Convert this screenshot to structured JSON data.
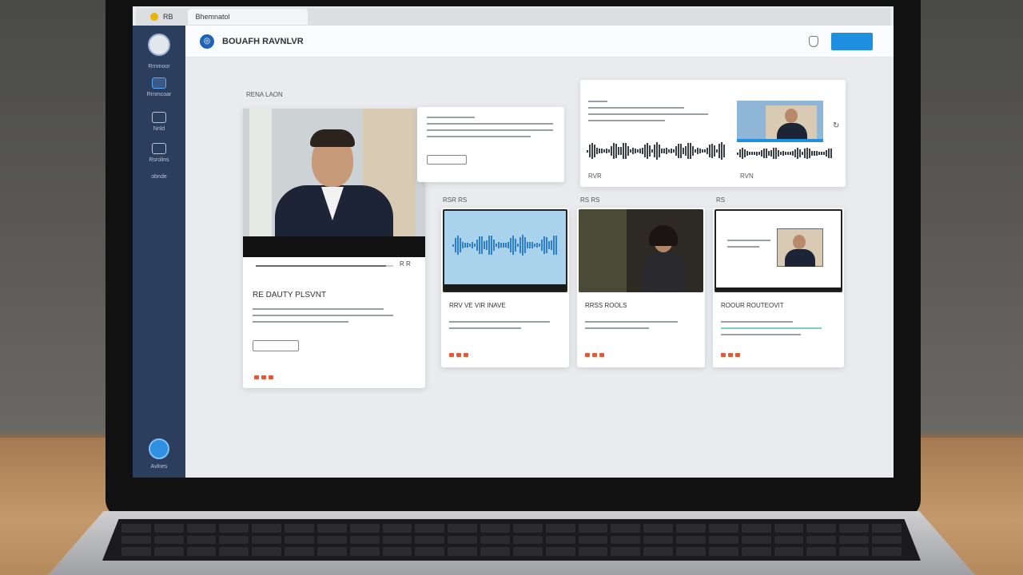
{
  "browser": {
    "tabs": [
      {
        "label": "RB"
      },
      {
        "label": "Bhemnatol"
      }
    ]
  },
  "app": {
    "title": "BOUAFH RAVNLVR",
    "primary_button": "",
    "sidebar": [
      {
        "label": "Rrnmoor",
        "icon": "home-icon"
      },
      {
        "label": "Rrnmcoar",
        "icon": "people-icon"
      },
      {
        "label": "Nnld",
        "icon": "chat-icon"
      },
      {
        "label": "Rsrolins",
        "icon": "calendar-icon"
      },
      {
        "label": "obnde",
        "icon": "settings-icon"
      }
    ],
    "sidebar_bottom_label": "Avlnes"
  },
  "sections": {
    "featured_label": "RENA LAON",
    "row_labels": [
      "RSR RS",
      "RS RS",
      "RS"
    ]
  },
  "featured": {
    "title": "RE DAUTY PLSVNT",
    "control_label": "R R",
    "progress": 0.95
  },
  "cards": [
    {
      "title": "RRV VE VIR INAVE",
      "type": "waveform"
    },
    {
      "title": "RRSS ROOLS",
      "type": "portrait"
    },
    {
      "title": "ROOUR ROUTEOVIT",
      "type": "screen"
    }
  ],
  "top_panel": {
    "left_label": "RVR",
    "right_label": "RVN"
  },
  "colors": {
    "accent": "#1f8fe0",
    "sidebar": "#2c3e5e",
    "rating": "#e05a3a"
  }
}
